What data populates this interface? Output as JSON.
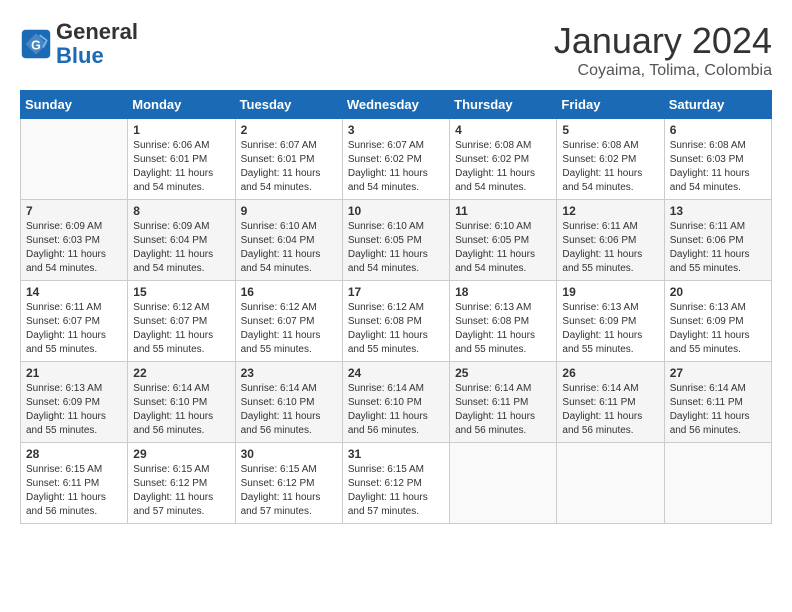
{
  "header": {
    "logo_line1": "General",
    "logo_line2": "Blue",
    "month": "January 2024",
    "location": "Coyaima, Tolima, Colombia"
  },
  "weekdays": [
    "Sunday",
    "Monday",
    "Tuesday",
    "Wednesday",
    "Thursday",
    "Friday",
    "Saturday"
  ],
  "weeks": [
    [
      {
        "day": "",
        "info": ""
      },
      {
        "day": "1",
        "info": "Sunrise: 6:06 AM\nSunset: 6:01 PM\nDaylight: 11 hours\nand 54 minutes."
      },
      {
        "day": "2",
        "info": "Sunrise: 6:07 AM\nSunset: 6:01 PM\nDaylight: 11 hours\nand 54 minutes."
      },
      {
        "day": "3",
        "info": "Sunrise: 6:07 AM\nSunset: 6:02 PM\nDaylight: 11 hours\nand 54 minutes."
      },
      {
        "day": "4",
        "info": "Sunrise: 6:08 AM\nSunset: 6:02 PM\nDaylight: 11 hours\nand 54 minutes."
      },
      {
        "day": "5",
        "info": "Sunrise: 6:08 AM\nSunset: 6:02 PM\nDaylight: 11 hours\nand 54 minutes."
      },
      {
        "day": "6",
        "info": "Sunrise: 6:08 AM\nSunset: 6:03 PM\nDaylight: 11 hours\nand 54 minutes."
      }
    ],
    [
      {
        "day": "7",
        "info": "Sunrise: 6:09 AM\nSunset: 6:03 PM\nDaylight: 11 hours\nand 54 minutes."
      },
      {
        "day": "8",
        "info": "Sunrise: 6:09 AM\nSunset: 6:04 PM\nDaylight: 11 hours\nand 54 minutes."
      },
      {
        "day": "9",
        "info": "Sunrise: 6:10 AM\nSunset: 6:04 PM\nDaylight: 11 hours\nand 54 minutes."
      },
      {
        "day": "10",
        "info": "Sunrise: 6:10 AM\nSunset: 6:05 PM\nDaylight: 11 hours\nand 54 minutes."
      },
      {
        "day": "11",
        "info": "Sunrise: 6:10 AM\nSunset: 6:05 PM\nDaylight: 11 hours\nand 54 minutes."
      },
      {
        "day": "12",
        "info": "Sunrise: 6:11 AM\nSunset: 6:06 PM\nDaylight: 11 hours\nand 55 minutes."
      },
      {
        "day": "13",
        "info": "Sunrise: 6:11 AM\nSunset: 6:06 PM\nDaylight: 11 hours\nand 55 minutes."
      }
    ],
    [
      {
        "day": "14",
        "info": "Sunrise: 6:11 AM\nSunset: 6:07 PM\nDaylight: 11 hours\nand 55 minutes."
      },
      {
        "day": "15",
        "info": "Sunrise: 6:12 AM\nSunset: 6:07 PM\nDaylight: 11 hours\nand 55 minutes."
      },
      {
        "day": "16",
        "info": "Sunrise: 6:12 AM\nSunset: 6:07 PM\nDaylight: 11 hours\nand 55 minutes."
      },
      {
        "day": "17",
        "info": "Sunrise: 6:12 AM\nSunset: 6:08 PM\nDaylight: 11 hours\nand 55 minutes."
      },
      {
        "day": "18",
        "info": "Sunrise: 6:13 AM\nSunset: 6:08 PM\nDaylight: 11 hours\nand 55 minutes."
      },
      {
        "day": "19",
        "info": "Sunrise: 6:13 AM\nSunset: 6:09 PM\nDaylight: 11 hours\nand 55 minutes."
      },
      {
        "day": "20",
        "info": "Sunrise: 6:13 AM\nSunset: 6:09 PM\nDaylight: 11 hours\nand 55 minutes."
      }
    ],
    [
      {
        "day": "21",
        "info": "Sunrise: 6:13 AM\nSunset: 6:09 PM\nDaylight: 11 hours\nand 55 minutes."
      },
      {
        "day": "22",
        "info": "Sunrise: 6:14 AM\nSunset: 6:10 PM\nDaylight: 11 hours\nand 56 minutes."
      },
      {
        "day": "23",
        "info": "Sunrise: 6:14 AM\nSunset: 6:10 PM\nDaylight: 11 hours\nand 56 minutes."
      },
      {
        "day": "24",
        "info": "Sunrise: 6:14 AM\nSunset: 6:10 PM\nDaylight: 11 hours\nand 56 minutes."
      },
      {
        "day": "25",
        "info": "Sunrise: 6:14 AM\nSunset: 6:11 PM\nDaylight: 11 hours\nand 56 minutes."
      },
      {
        "day": "26",
        "info": "Sunrise: 6:14 AM\nSunset: 6:11 PM\nDaylight: 11 hours\nand 56 minutes."
      },
      {
        "day": "27",
        "info": "Sunrise: 6:14 AM\nSunset: 6:11 PM\nDaylight: 11 hours\nand 56 minutes."
      }
    ],
    [
      {
        "day": "28",
        "info": "Sunrise: 6:15 AM\nSunset: 6:11 PM\nDaylight: 11 hours\nand 56 minutes."
      },
      {
        "day": "29",
        "info": "Sunrise: 6:15 AM\nSunset: 6:12 PM\nDaylight: 11 hours\nand 57 minutes."
      },
      {
        "day": "30",
        "info": "Sunrise: 6:15 AM\nSunset: 6:12 PM\nDaylight: 11 hours\nand 57 minutes."
      },
      {
        "day": "31",
        "info": "Sunrise: 6:15 AM\nSunset: 6:12 PM\nDaylight: 11 hours\nand 57 minutes."
      },
      {
        "day": "",
        "info": ""
      },
      {
        "day": "",
        "info": ""
      },
      {
        "day": "",
        "info": ""
      }
    ]
  ]
}
